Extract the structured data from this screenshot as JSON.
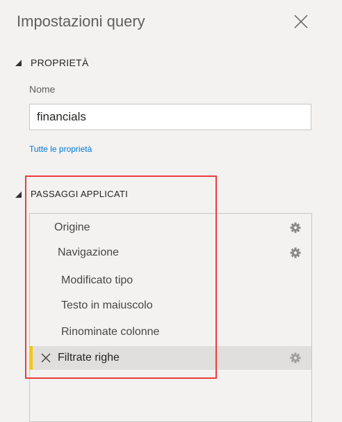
{
  "panel": {
    "title": "Impostazioni query"
  },
  "properties": {
    "heading": "PROPRIETÀ",
    "name_label": "Nome",
    "name_value": "financials",
    "all_properties_link": "Tutte le proprietà"
  },
  "applied_steps": {
    "heading": "PASSAGGI APPLICATI",
    "items": [
      {
        "label": "Origine",
        "has_settings": true,
        "selected": false
      },
      {
        "label": "Navigazione",
        "has_settings": true,
        "selected": false
      },
      {
        "label": "Modificato tipo",
        "has_settings": false,
        "selected": false
      },
      {
        "label": "Testo in maiuscolo",
        "has_settings": false,
        "selected": false
      },
      {
        "label": "Rinominate colonne",
        "has_settings": false,
        "selected": false
      },
      {
        "label": "Filtrate righe",
        "has_settings": true,
        "selected": true
      }
    ]
  },
  "icons": {
    "close": "close-icon",
    "collapse": "collapse-triangle-icon",
    "settings": "gear-icon",
    "delete_step": "delete-x-icon"
  },
  "colors": {
    "background": "#f3f2f1",
    "selected_row": "#e1dfdd",
    "selected_marker": "#f2c811",
    "link": "#0078d4",
    "annotation_border": "#e83d3d"
  }
}
